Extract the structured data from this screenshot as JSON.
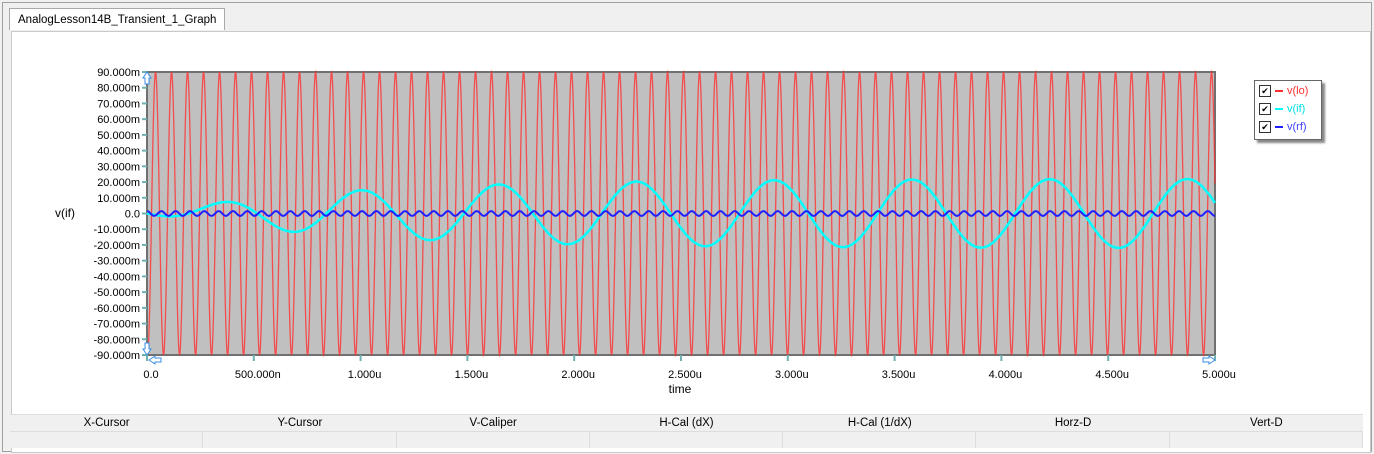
{
  "tab": {
    "label": "AnalogLesson14B_Transient_1_Graph"
  },
  "cursor_table": {
    "columns": [
      "X-Cursor",
      "Y-Cursor",
      "V-Caliper",
      "H-Cal (dX)",
      "H-Cal (1/dX)",
      "Horz-D",
      "Vert-D"
    ]
  },
  "chart_data": {
    "type": "line",
    "xlabel": "time",
    "ylabel": "v(if)",
    "xlim": [
      0,
      5e-06
    ],
    "ylim": [
      -0.09,
      0.09
    ],
    "x_ticks": [
      "0.0",
      "500.000n",
      "1.000u",
      "1.500u",
      "2.000u",
      "2.500u",
      "3.000u",
      "3.500u",
      "4.000u",
      "4.500u",
      "5.000u"
    ],
    "y_ticks": [
      "90.000m",
      "80.000m",
      "70.000m",
      "60.000m",
      "50.000m",
      "40.000m",
      "30.000m",
      "20.000m",
      "10.000m",
      "0.0",
      "-10.000m",
      "-20.000m",
      "-30.000m",
      "-40.000m",
      "-50.000m",
      "-60.000m",
      "-70.000m",
      "-80.000m",
      "-90.000m"
    ],
    "grid": false,
    "plot_background": "#c0c0c0",
    "legend_position": "top-right",
    "series": [
      {
        "name": "v(lo)",
        "color": "#ff3030",
        "label_color": "#ff3030",
        "shape": "sine",
        "amplitude_V": 0.09,
        "frequency_Hz": 13350000,
        "phase_peak_s": 4e-08
      },
      {
        "name": "v(if)",
        "color": "#00ffff",
        "label_color": "#00e0e0",
        "shape": "growing-sine",
        "amplitude_V": 0.022,
        "tau_s": 9e-07,
        "frequency_Hz": 1550000,
        "phase_peak_s": 1e-06
      },
      {
        "name": "v(rf)",
        "color": "#2020ff",
        "label_color": "#4040ff",
        "shape": "sine",
        "amplitude_V": 0.0015,
        "frequency_Hz": 14900000,
        "phase_peak_s": 0.0
      }
    ]
  }
}
